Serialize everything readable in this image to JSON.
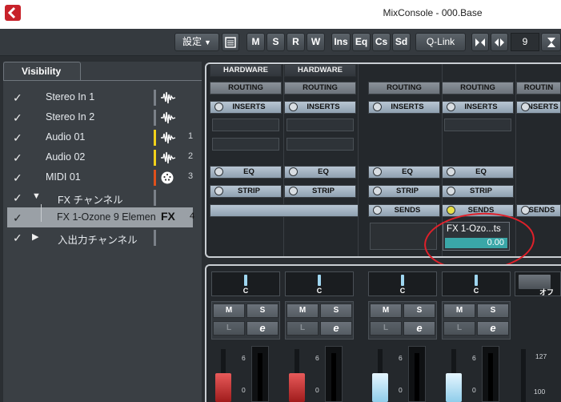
{
  "window": {
    "title": "MixConsole - 000.Base"
  },
  "toolbar": {
    "settings_label": "設定",
    "settings_caret": "▼",
    "list_icon": "list-icon",
    "m_label": "M",
    "s_label": "S",
    "r_label": "R",
    "w_label": "W",
    "ins_label": "Ins",
    "eq_label": "Eq",
    "cs_label": "Cs",
    "sd_label": "Sd",
    "qlink_label": "Q-Link",
    "channel_count": "9"
  },
  "visibility": {
    "tab_label": "Visibility",
    "items": [
      {
        "label": "Stereo In 1",
        "color": "#7a8088",
        "icon": "audio-wave-icon",
        "num": ""
      },
      {
        "label": "Stereo In 2",
        "color": "#7a8088",
        "icon": "audio-wave-icon",
        "num": ""
      },
      {
        "label": "Audio 01",
        "color": "#f2d21a",
        "icon": "audio-wave-icon",
        "num": "1"
      },
      {
        "label": "Audio 02",
        "color": "#f2d21a",
        "icon": "audio-wave-icon",
        "num": "2"
      },
      {
        "label": "MIDI 01",
        "color": "#e0501c",
        "icon": "midi-port-icon",
        "num": "3"
      },
      {
        "label": "FX チャンネル",
        "color": "#7a8088",
        "icon": "",
        "num": ""
      },
      {
        "label": "FX 1-Ozone 9 Elemen",
        "color": "",
        "icon": "",
        "num": "4",
        "fx": "FX"
      },
      {
        "label": "入出力チャンネル",
        "color": "#7a8088",
        "icon": "",
        "num": ""
      }
    ]
  },
  "rack": {
    "hardware": [
      "HARDWARE",
      "HARDWARE"
    ],
    "routing": [
      "ROUTING",
      "ROUTING",
      "ROUTING",
      "ROUTING",
      "ROUTIN"
    ],
    "inserts": [
      "INSERTS",
      "INSERTS",
      "INSERTS",
      "INSERTS",
      "INSERTS"
    ],
    "eq": [
      "EQ",
      "EQ",
      "EQ",
      "EQ"
    ],
    "strip": [
      "STRIP",
      "STRIP",
      "STRIP",
      "STRIP"
    ],
    "sends": [
      "SENDS",
      "SENDS",
      "SENDS"
    ]
  },
  "send": {
    "name": "FX 1-Ozo...ts",
    "value": "0.00"
  },
  "mixer": {
    "pan_labels": [
      "C",
      "C",
      "C",
      "C",
      "オフ"
    ],
    "mute": "M",
    "solo": "S",
    "listen": "L",
    "edit": "e",
    "scale": [
      "6",
      "0",
      "6",
      "0",
      "6",
      "0",
      "6",
      "0",
      "127",
      "100"
    ],
    "meter_ticks": [
      "6",
      "0"
    ]
  }
}
